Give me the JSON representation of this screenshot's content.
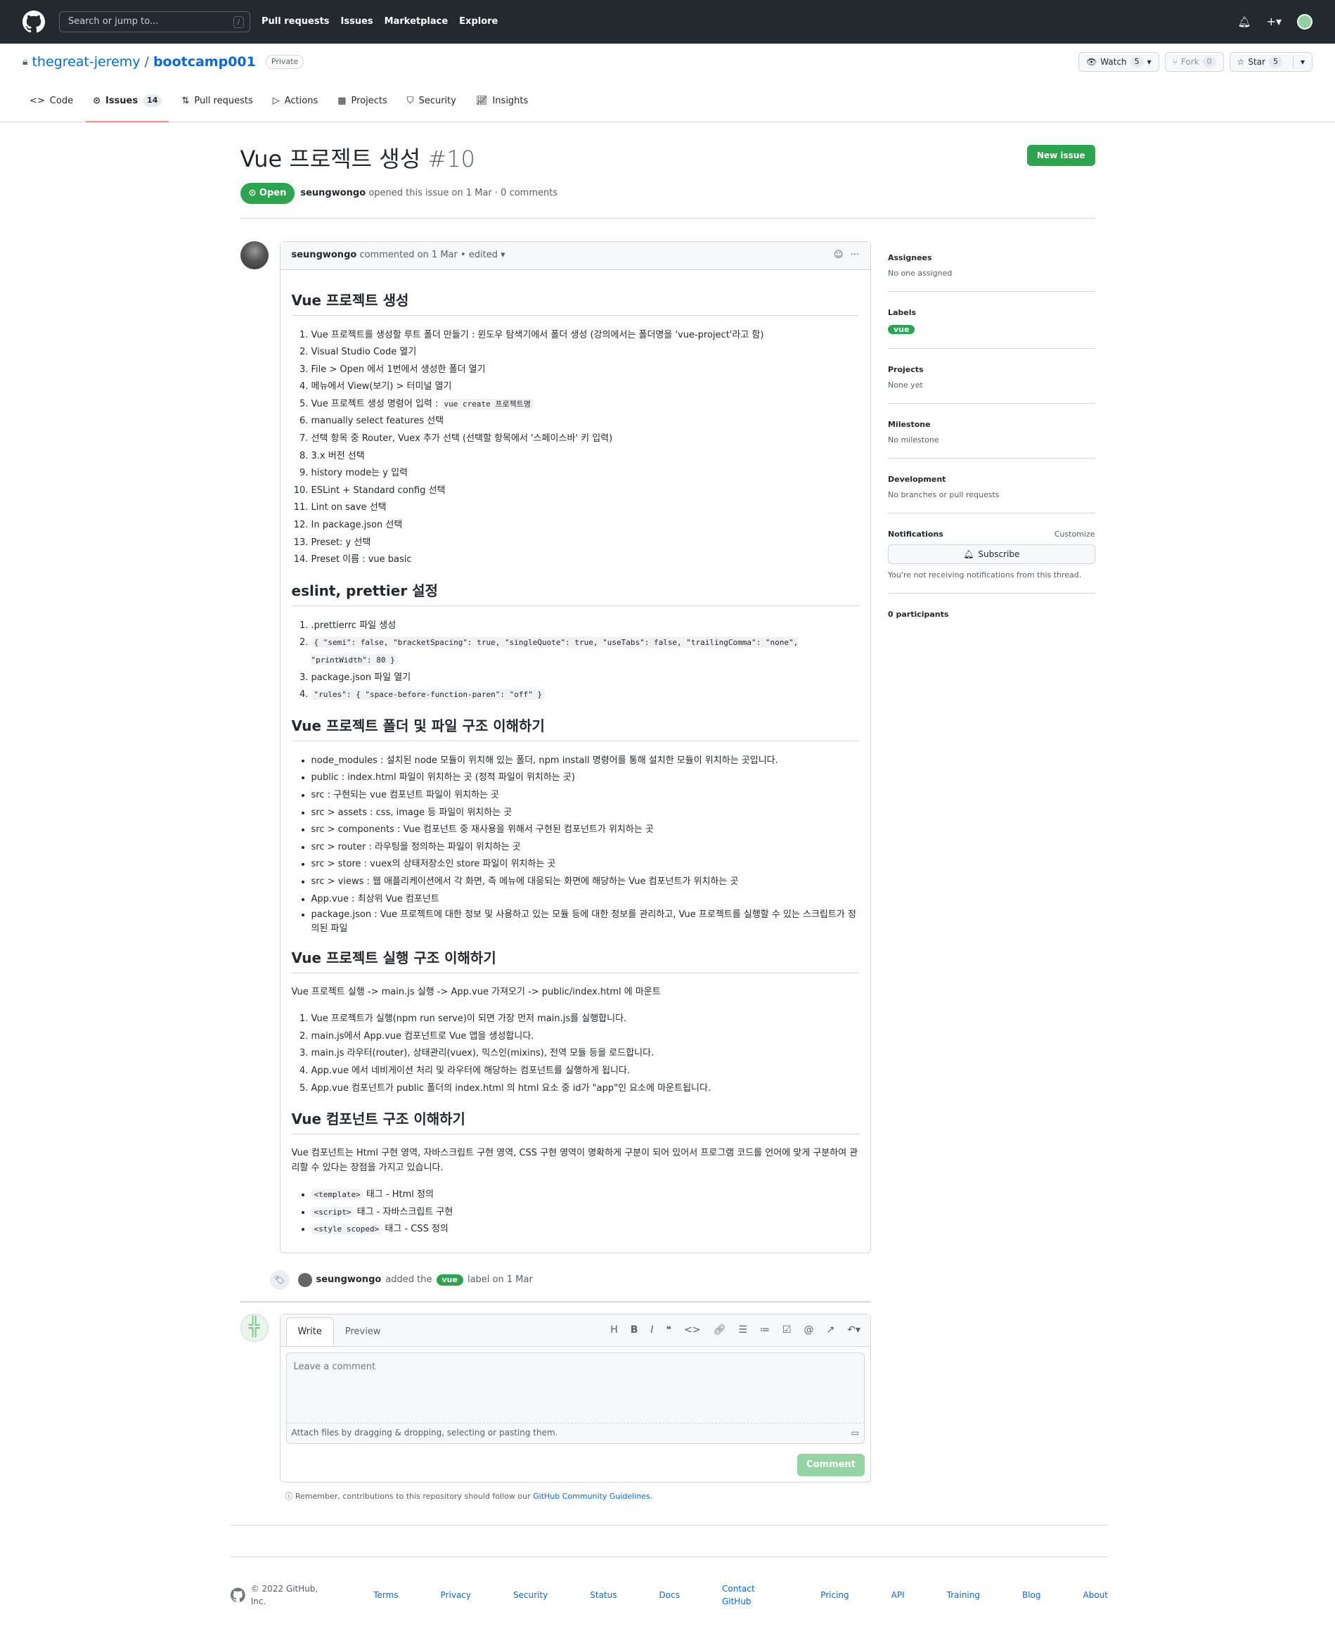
{
  "header": {
    "search_placeholder": "Search or jump to...",
    "search_key": "/",
    "nav": [
      "Pull requests",
      "Issues",
      "Marketplace",
      "Explore"
    ]
  },
  "repo": {
    "owner": "thegreat-jeremy",
    "sep": "/",
    "name": "bootcamp001",
    "visibility": "Private",
    "watch": "Watch",
    "watch_count": "5",
    "fork": "Fork",
    "fork_count": "0",
    "star": "Star",
    "star_count": "5"
  },
  "tabs": [
    {
      "label": "Code"
    },
    {
      "label": "Issues",
      "count": "14"
    },
    {
      "label": "Pull requests"
    },
    {
      "label": "Actions"
    },
    {
      "label": "Projects"
    },
    {
      "label": "Security"
    },
    {
      "label": "Insights"
    }
  ],
  "issue": {
    "title": "Vue 프로젝트 생성",
    "number": "#10",
    "new_issue": "New issue",
    "state": "Open",
    "author": "seungwongo",
    "opened": "opened this issue on 1 Mar · 0 comments"
  },
  "comment": {
    "author": "seungwongo",
    "meta": "commented on 1 Mar • edited",
    "h1": "Vue 프로젝트 생성",
    "steps": [
      "Vue 프로젝트를 생성할 루트 폴더 만들기 : 윈도우 탐색기에서 폴더 생성 (강의에서는 폴더명을 'vue-project'라고 함)",
      "Visual Studio Code 열기",
      "File > Open 에서 1번에서 생성한 폴더 열기",
      "메뉴에서 View(보기) > 터미널 열기",
      "Vue 프로젝트 생성 명령어 입력 :",
      "manually select features 선택",
      "선택 항목 중 Router, Vuex 추가 선택 (선택할 항목에서 '스페이스바' 키 입력)",
      "3.x 버전 선택",
      "history mode는 y 입력",
      "ESLint + Standard config 선택",
      "Lint on save 선택",
      "In package.json 선택",
      "Preset: y 선택",
      "Preset 이름 : vue basic"
    ],
    "cmd": "vue create 프로젝트명",
    "h2": "eslint, prettier 설정",
    "es1": ".prettierrc 파일 생성",
    "es2": "{ \"semi\": false, \"bracketSpacing\": true, \"singleQuote\": true, \"useTabs\": false, \"trailingComma\": \"none\", \"printWidth\": 80 }",
    "es3": "package.json 파일 열기",
    "es4": "\"rules\": { \"space-before-function-paren\": \"off\" }",
    "h3": "Vue 프로젝트 폴더 및 파일 구조 이해하기",
    "folders": [
      "node_modules : 설치된 node 모듈이 위치해 있는 폴더, npm install 명령어를 통해 설치한 모듈이 위치하는 곳입니다.",
      "public : index.html 파일이 위치하는 곳 (정적 파일이 위치하는 곳)",
      "src : 구현되는 vue 컴포넌트 파일이 위치하는 곳",
      "src > assets : css, image 등 파일이 위치하는 곳",
      "src > components : Vue 컴포넌트 중 재사용을 위해서 구현된 컴포넌트가 위치하는 곳",
      "src > router : 라우팅을 정의하는 파일이 위치하는 곳",
      "src > store : vuex의 상태저장소인 store 파일이 위치하는 곳",
      "src > views : 웹 애플리케이션에서 각 화면, 즉 메뉴에 대응되는 화면에 해당하는 Vue 컴포넌트가 위치하는 곳",
      "App.vue : 최상위 Vue 컴포넌트",
      "package.json : Vue 프로젝트에 대한 정보 및 사용하고 있는 모듈 등에 대한 정보를 관리하고, Vue 프로젝트를 실행할 수 있는 스크립트가 정의된 파일"
    ],
    "h4": "Vue 프로젝트 실행 구조 이해하기",
    "run_p": "Vue 프로젝트 실행 -> main.js 실행 -> App.vue 가져오기 -> public/index.html 에 마운트",
    "run": [
      "Vue 프로젝트가 실행(npm run serve)이 되면 가장 먼저 main.js를 실행합니다.",
      "main.js에서 App.vue 컴포넌트로 Vue 앱을 생성합니다.",
      "main.js 라우터(router), 상태관리(vuex), 믹스인(mixins), 전역 모듈 등을 로드합니다.",
      "App.vue 에서 네비게이션 처리 및 라우터에 해당하는 컴포넌트를 실행하게 됩니다.",
      "App.vue 컴포넌트가 public 폴더의 index.html 의 html 요소 중 id가 \"app\"인 요소에 마운트됩니다."
    ],
    "h5": "Vue 컴포넌트 구조 이해하기",
    "comp_p": "Vue 컴포넌트는 Html 구현 영역, 자바스크립트 구현 영역, CSS 구현 영역이 명확하게 구분이 되어 있어서 프로그램 코드를 언어에 맞게 구분하여 관리할 수 있다는 장점을 가지고 있습니다.",
    "tags": [
      {
        "code": "<template>",
        "text": "태그 - Html 정의"
      },
      {
        "code": "<script>",
        "text": "태그 - 자바스크립트 구현"
      },
      {
        "code": "<style scoped>",
        "text": "태그 - CSS 정의"
      }
    ]
  },
  "event": {
    "author": "seungwongo",
    "pre": "added the",
    "label": "vue",
    "post": "label on 1 Mar"
  },
  "editor": {
    "write": "Write",
    "preview": "Preview",
    "placeholder": "Leave a comment",
    "attach": "Attach files by dragging & dropping, selecting or pasting them.",
    "submit": "Comment",
    "remember": "Remember, contributions to this repository should follow our",
    "guidelines": "GitHub Community Guidelines",
    "period": "."
  },
  "sidebar": {
    "assignees": "Assignees",
    "assignees_v": "No one assigned",
    "labels": "Labels",
    "label": "vue",
    "projects": "Projects",
    "projects_v": "None yet",
    "milestone": "Milestone",
    "milestone_v": "No milestone",
    "development": "Development",
    "development_v": "No branches or pull requests",
    "notifications": "Notifications",
    "customize": "Customize",
    "subscribe": "Subscribe",
    "notif_v": "You're not receiving notifications from this thread.",
    "participants": "0 participants"
  },
  "footer": {
    "copy": "© 2022 GitHub, Inc.",
    "links": [
      "Terms",
      "Privacy",
      "Security",
      "Status",
      "Docs",
      "Contact GitHub",
      "Pricing",
      "API",
      "Training",
      "Blog",
      "About"
    ]
  },
  "colors": {
    "accent": "#0969da",
    "green": "#2da44e",
    "header": "#24292f"
  }
}
